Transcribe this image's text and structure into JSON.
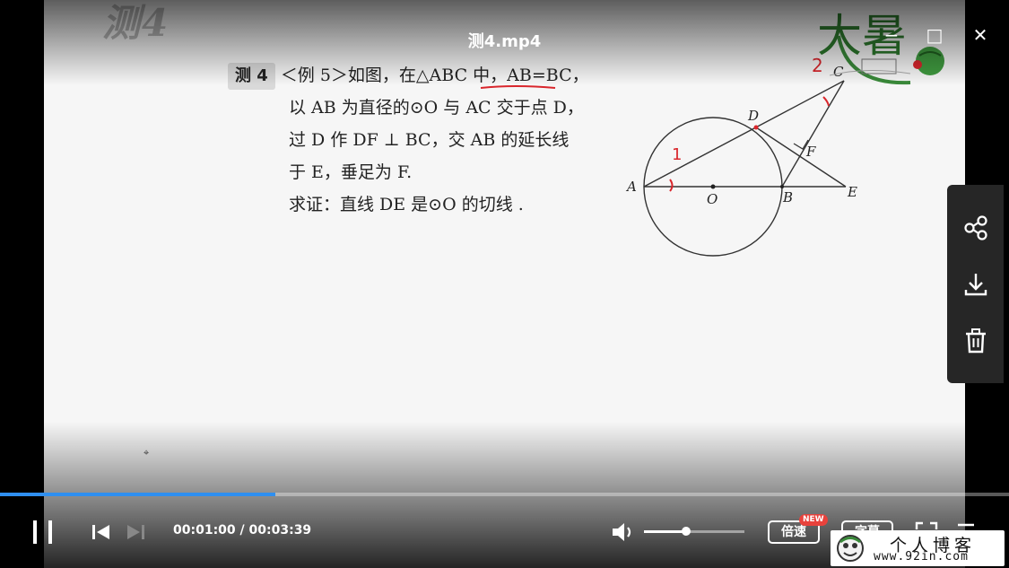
{
  "window": {
    "title": "测4.mp4",
    "minimize_glyph": "−",
    "maximize_glyph": "□",
    "close_glyph": "✕"
  },
  "video": {
    "watermark_title": "测4",
    "problem": {
      "tag": "测 4",
      "lines": [
        "＜例 5＞如图，在△ABC 中，AB=BC，",
        "以 AB 为直径的⊙O 与 AC 交于点 D，",
        "过 D 作 DF ⊥ BC，交 AB 的延长线",
        "于 E，垂足为 F.",
        "求证：直线 DE 是⊙O 的切线 ."
      ]
    },
    "figure_labels": {
      "a": "A",
      "b": "B",
      "c": "C",
      "d": "D",
      "e": "E",
      "f": "F",
      "o": "O",
      "mark_1": "1",
      "mark_2": "2"
    },
    "logo_text": "大暑"
  },
  "side_panel": {
    "items": [
      {
        "name": "share-icon"
      },
      {
        "name": "download-icon"
      },
      {
        "name": "delete-icon"
      }
    ]
  },
  "playback": {
    "progress": 0.273,
    "time_current": "00:01:00",
    "time_separator": " / ",
    "time_total": "00:03:39",
    "volume": 0.42,
    "speed_label": "倍速",
    "speed_badge": "NEW",
    "subtitle_label": "字幕"
  },
  "blog_badge": {
    "name": "个人博客",
    "url": "www.92in.com"
  },
  "colors": {
    "progress": "#2f8ff0",
    "annotation_red": "#d9262c",
    "badge_red": "#e8423c"
  }
}
